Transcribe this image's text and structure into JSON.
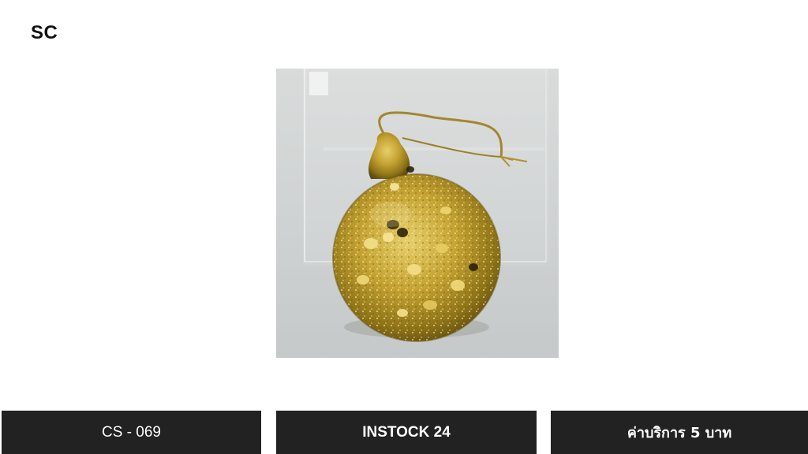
{
  "brand": {
    "logo_text": "SC"
  },
  "product": {
    "image_icon": "gold-glitter-ornament-ball",
    "code": "CS - 069",
    "stock": "INSTOCK 24",
    "service_fee": "ค่าบริการ 5 บาท"
  },
  "colors": {
    "bar_background": "#222222",
    "bar_text": "#ffffff",
    "ornament_gold": "#b8962a"
  }
}
